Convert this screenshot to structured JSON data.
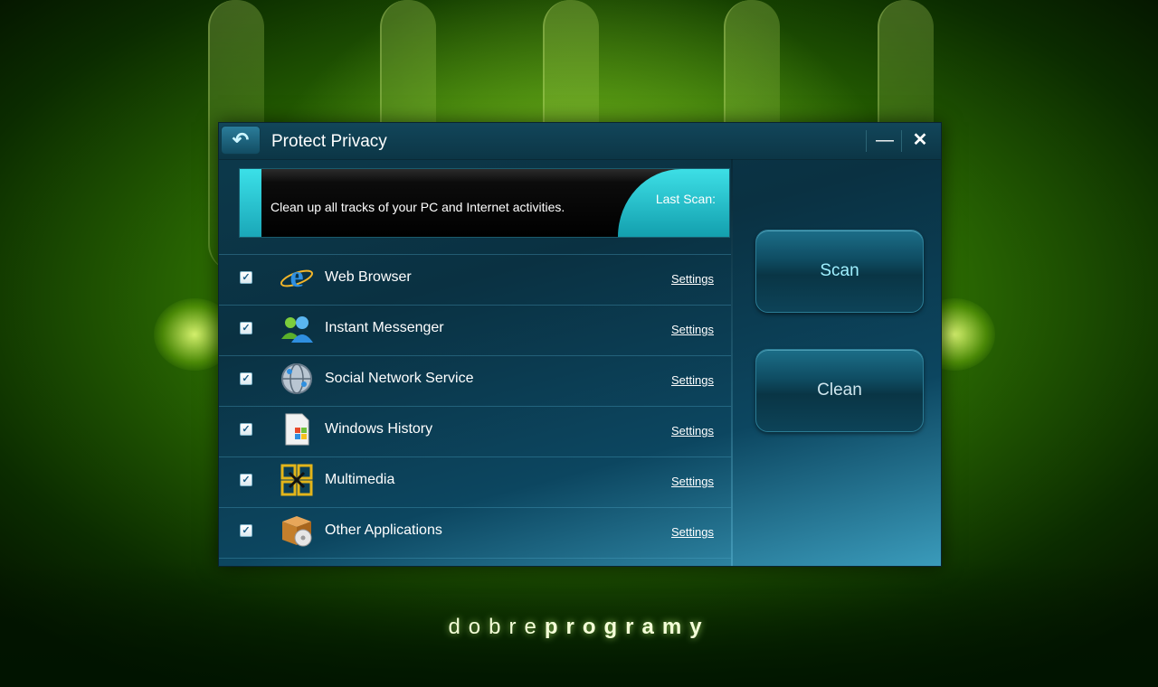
{
  "window": {
    "title": "Protect Privacy",
    "back_icon": "↶",
    "minimize_glyph": "—",
    "close_glyph": "✕"
  },
  "banner": {
    "text": "Clean up all tracks of your PC and Internet activities.",
    "last_scan_label": "Last Scan:"
  },
  "items": [
    {
      "label": "Web Browser",
      "settings": "Settings",
      "checked": true,
      "icon": "internet-explorer-icon"
    },
    {
      "label": "Instant Messenger",
      "settings": "Settings",
      "checked": true,
      "icon": "messenger-icon"
    },
    {
      "label": "Social Network Service",
      "settings": "Settings",
      "checked": true,
      "icon": "globe-network-icon"
    },
    {
      "label": "Windows History",
      "settings": "Settings",
      "checked": true,
      "icon": "windows-document-icon"
    },
    {
      "label": "Multimedia",
      "settings": "Settings",
      "checked": true,
      "icon": "multimedia-icon"
    },
    {
      "label": "Other Applications",
      "settings": "Settings",
      "checked": true,
      "icon": "software-box-icon"
    }
  ],
  "actions": {
    "scan_label": "Scan",
    "clean_label": "Clean"
  },
  "brand": {
    "part1": "dobre",
    "part2": "programy"
  },
  "colors": {
    "accent_cyan": "#3ddfe6",
    "window_bg": "#0c3646",
    "background_green": "#4f9a06"
  }
}
